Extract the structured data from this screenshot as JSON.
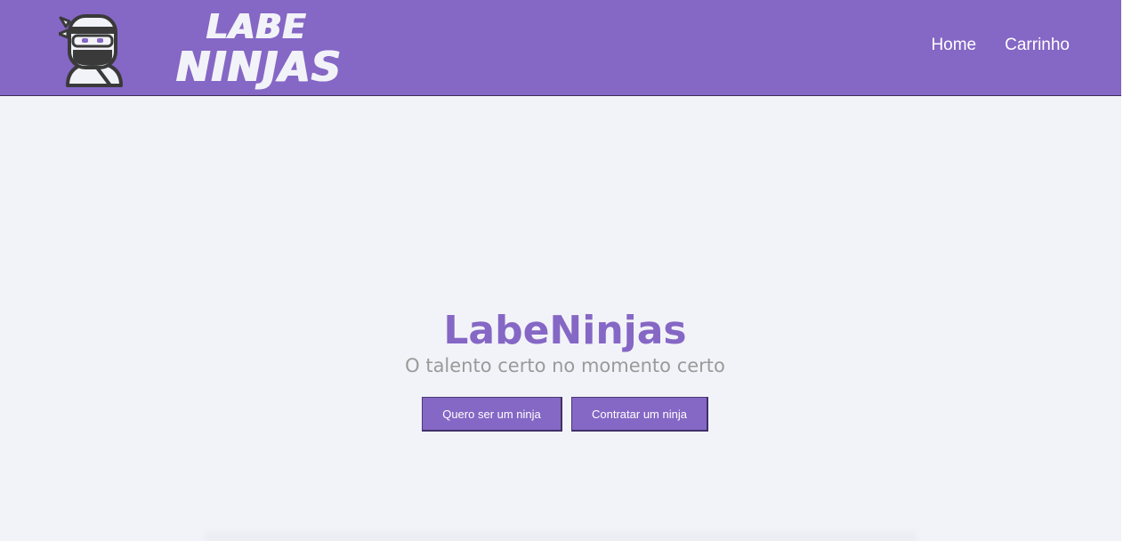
{
  "header": {
    "background_color": "#8567c5",
    "logo_icon": "ninja-icon",
    "brand_top": "LABE",
    "brand_bottom": "NINJAS",
    "nav": [
      {
        "label": "Home"
      },
      {
        "label": "Carrinho"
      }
    ]
  },
  "hero": {
    "title": "LabeNinjas",
    "subtitle": "O talento certo no momento certo",
    "buttons": [
      {
        "label": "Quero ser um ninja"
      },
      {
        "label": "Contratar um ninja"
      }
    ]
  },
  "colors": {
    "accent": "#8567c5",
    "page_background": "#f2f3f8",
    "subtitle_text": "#9a9a9a"
  }
}
